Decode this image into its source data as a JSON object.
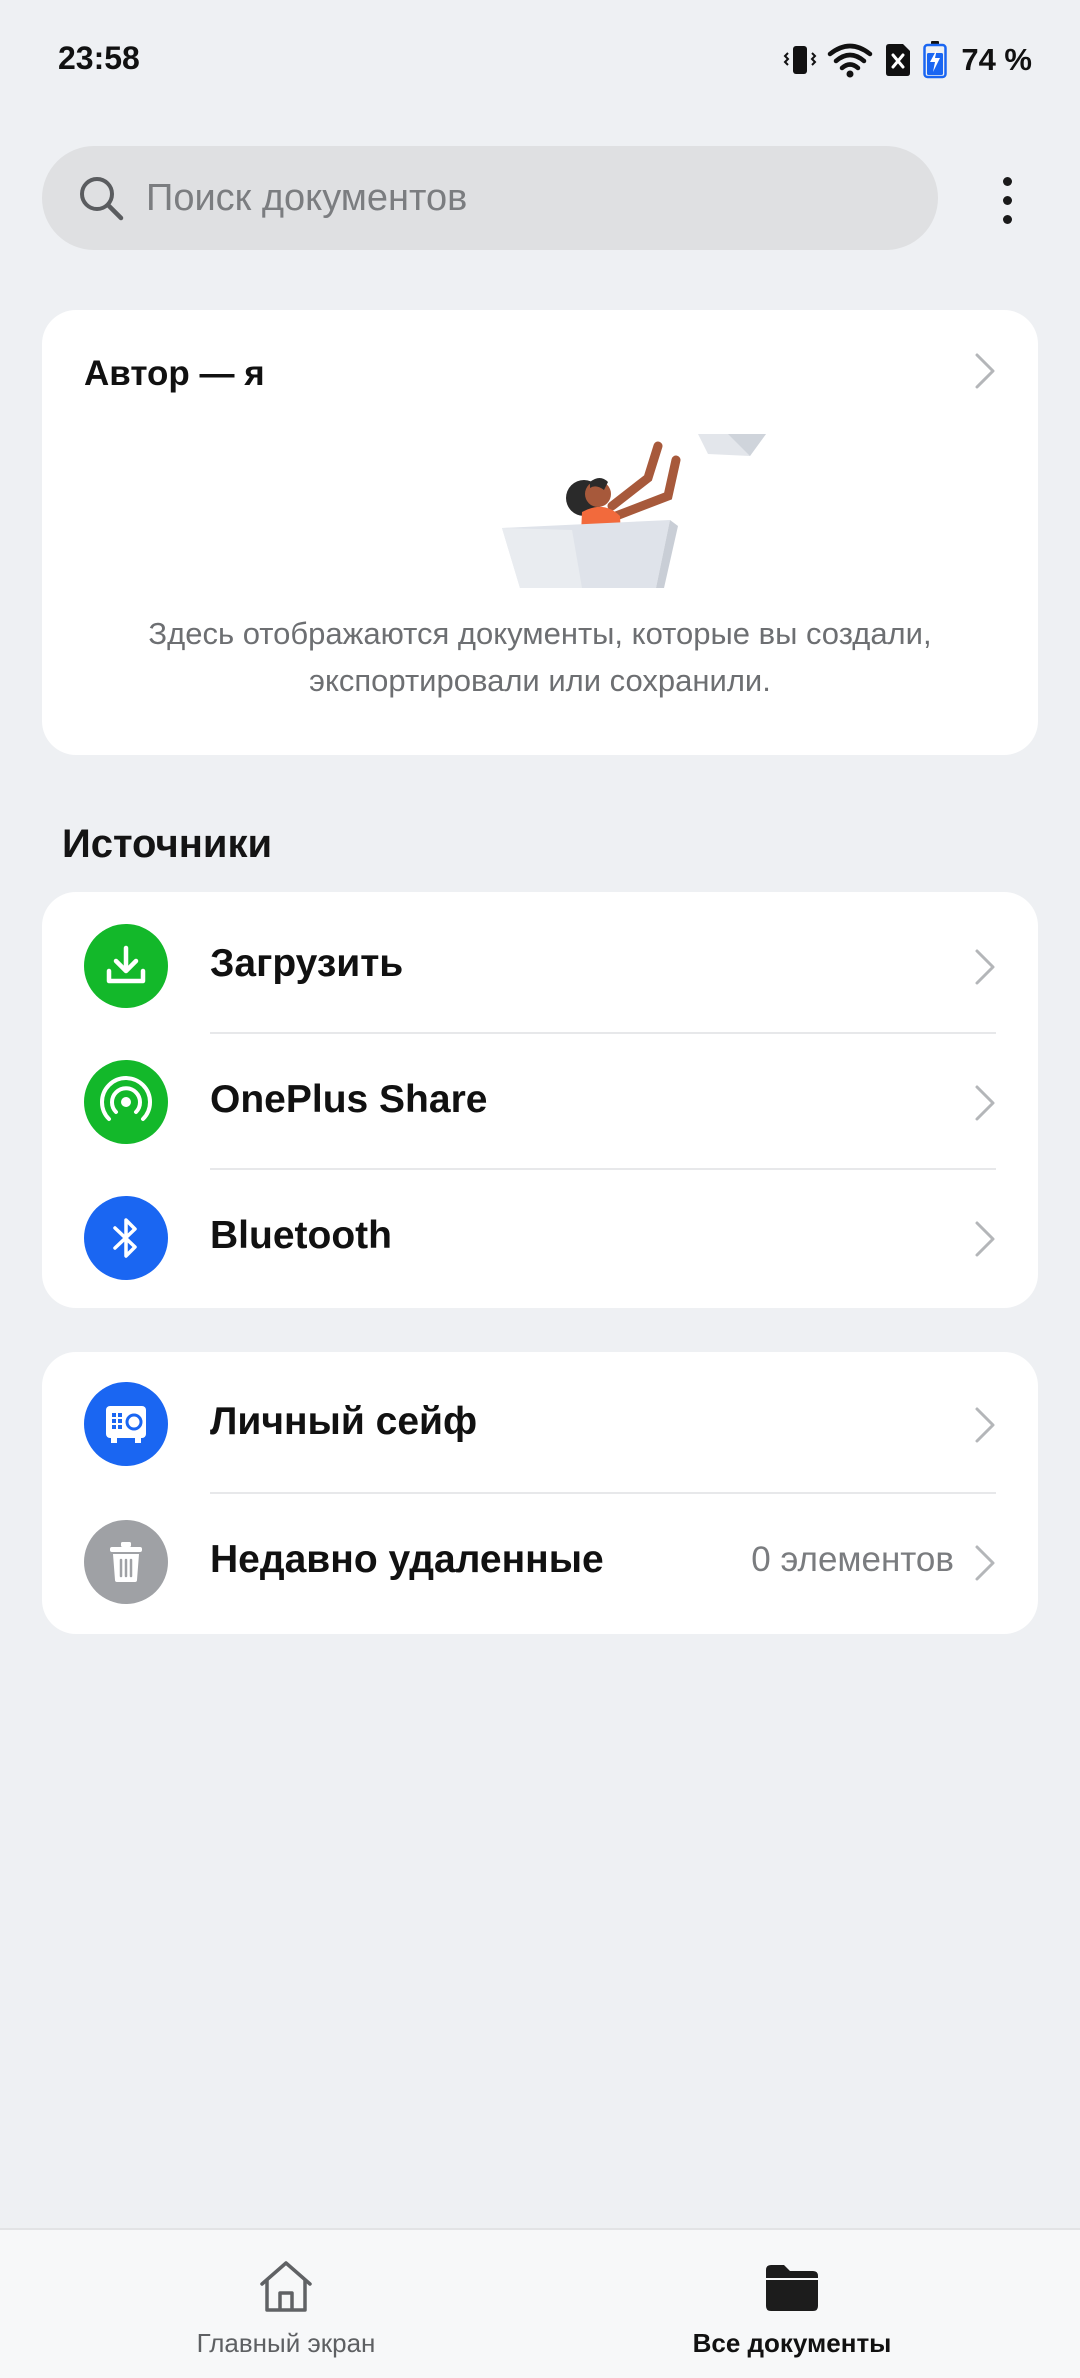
{
  "status_bar": {
    "time": "23:58",
    "battery": "74 %",
    "icons": [
      "vibrate-icon",
      "wifi-icon",
      "sim-off-icon",
      "battery-charging-icon"
    ]
  },
  "search": {
    "placeholder": "Поиск документов",
    "icon": "search-icon"
  },
  "more_menu_icon": "more-vertical-icon",
  "author_card": {
    "title": "Автор — я",
    "description": "Здесь отображаются документы, которые вы создали, экспортировали или сохранили."
  },
  "sources": {
    "title": "Источники",
    "items": [
      {
        "label": "Загрузить",
        "icon": "download-icon",
        "color": "#13b82a"
      },
      {
        "label": "OnePlus Share",
        "icon": "share-signal-icon",
        "color": "#13b82a"
      },
      {
        "label": "Bluetooth",
        "icon": "bluetooth-icon",
        "color": "#1a66f2"
      }
    ]
  },
  "storage": {
    "items": [
      {
        "label": "Личный сейф",
        "icon": "safe-icon",
        "color": "#1a66f2",
        "value": ""
      },
      {
        "label": "Недавно удаленные",
        "icon": "trash-icon",
        "color": "#9fa1a5",
        "value": "0 элементов"
      }
    ]
  },
  "bottom_nav": {
    "items": [
      {
        "label": "Главный экран",
        "icon": "home-icon",
        "active": false
      },
      {
        "label": "Все документы",
        "icon": "folder-icon",
        "active": true
      }
    ]
  }
}
